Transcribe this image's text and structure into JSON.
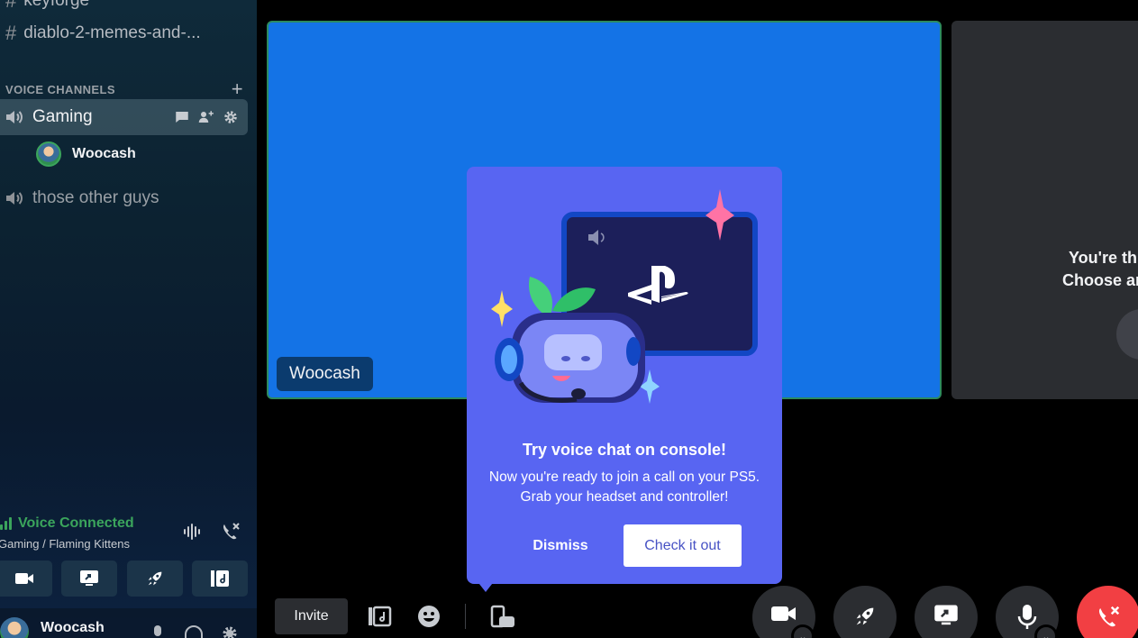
{
  "sidebar": {
    "top_channel_partial": "keyforge",
    "channel_memes": "diablo-2-memes-and-...",
    "voice_header": "VOICE CHANNELS",
    "voice_channels": [
      {
        "label": "Gaming",
        "members": [
          "Woocash"
        ]
      },
      {
        "label": "those other guys"
      }
    ],
    "voice_connected": {
      "status": "Voice Connected",
      "location": "Gaming / Flaming Kittens"
    },
    "user": {
      "name": "Woocash"
    }
  },
  "stage": {
    "tile_name": "Woocash",
    "right_tile_lines": [
      "You're th",
      "Choose ar"
    ]
  },
  "popup": {
    "title": "Try voice chat on console!",
    "description": "Now you're ready to join a call on your PS5. Grab your headset and controller!",
    "dismiss_label": "Dismiss",
    "check_label": "Check it out"
  },
  "controls": {
    "invite_label": "Invite"
  },
  "colors": {
    "blurple": "#5865f2",
    "tile_blue": "#1473e6",
    "green": "#3ba55c",
    "red": "#f23f43"
  }
}
